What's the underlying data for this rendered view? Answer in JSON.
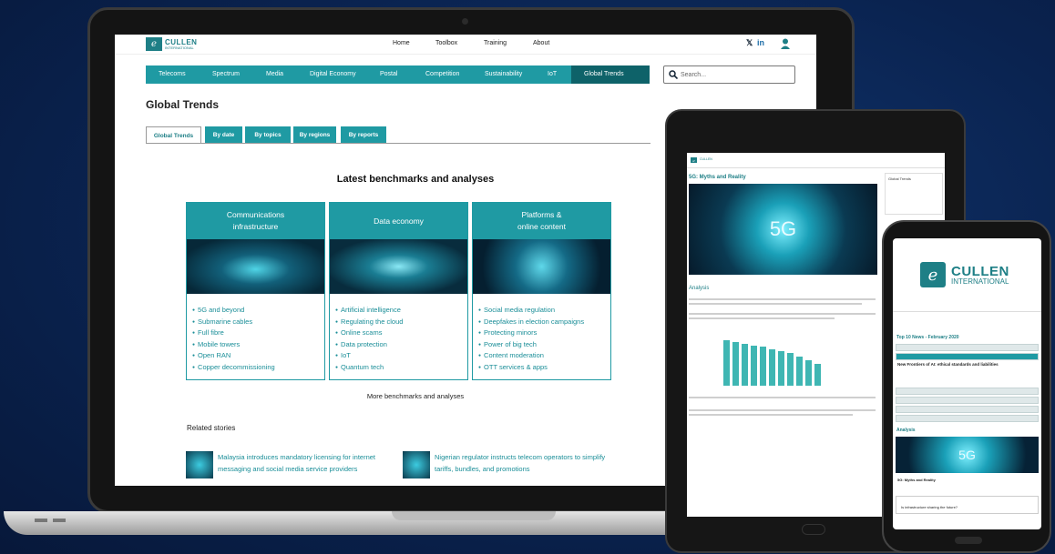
{
  "brand": {
    "logo_top": "CULLEN",
    "logo_bottom": "INTERNATIONAL"
  },
  "topnav": [
    "Home",
    "Toolbox",
    "Training",
    "About"
  ],
  "social": {
    "x": "𝕏",
    "linkedin": "in"
  },
  "categories": [
    "Telecoms",
    "Spectrum",
    "Media",
    "Digital Economy",
    "Postal",
    "Competition",
    "Sustainability",
    "IoT",
    "Global Trends"
  ],
  "search": {
    "placeholder": "Search..."
  },
  "page_title": "Global Trends",
  "subtabs": [
    "Global Trends",
    "By date",
    "By topics",
    "By regions",
    "By reports"
  ],
  "heading": "Latest benchmarks and analyses",
  "cards": [
    {
      "title": "Communications\ninfrastructure",
      "items": [
        "5G and beyond",
        "Submarine cables",
        "Full fibre",
        "Mobile towers",
        "Open RAN",
        "Copper decommissioning"
      ]
    },
    {
      "title": "Data economy",
      "items": [
        "Artificial intelligence",
        "Regulating the cloud",
        "Online scams",
        "Data protection",
        "IoT",
        "Quantum tech"
      ]
    },
    {
      "title": "Platforms &\nonline content",
      "items": [
        "Social media regulation",
        "Deepfakes in election campaigns",
        "Protecting minors",
        "Power of big tech",
        "Content moderation",
        "OTT services & apps"
      ]
    }
  ],
  "more_link": "More benchmarks and analyses",
  "related_title": "Related stories",
  "stories": [
    "Malaysia introduces mandatory licensing for internet messaging and social media service providers",
    "Nigerian regulator instructs telecom operators to simplify tariffs, bundles, and promotions"
  ],
  "tablet": {
    "article_title": "5G: Myths and Reality",
    "hero_text": "5G",
    "section": "Analysis",
    "side_title": "Global Trends"
  },
  "phone": {
    "top10": "Top 10 News - February 2020",
    "headline": "New Frontiers of AI: ethical standards and liabilities",
    "section": "Analysis",
    "hero_text": "5G",
    "caption": "5G: Myths and Reality",
    "teaser": "Is infrastructure sharing the future?"
  }
}
